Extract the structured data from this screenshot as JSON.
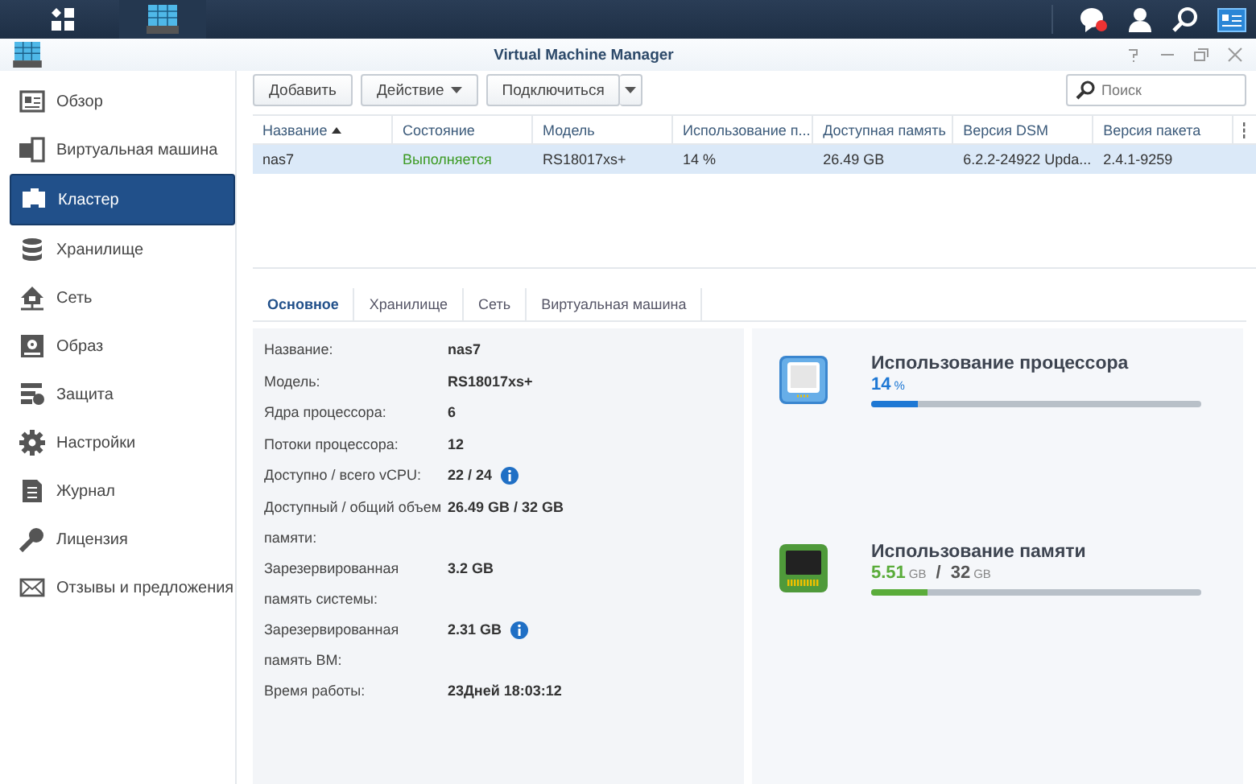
{
  "window": {
    "title": "Virtual Machine Manager"
  },
  "sidebar": {
    "items": [
      {
        "label": "Обзор",
        "selected": false
      },
      {
        "label": "Виртуальная машина",
        "selected": false
      },
      {
        "label": "Кластер",
        "selected": true
      },
      {
        "label": "Хранилище",
        "selected": false
      },
      {
        "label": "Сеть",
        "selected": false
      },
      {
        "label": "Образ",
        "selected": false
      },
      {
        "label": "Защита",
        "selected": false
      },
      {
        "label": "Настройки",
        "selected": false
      },
      {
        "label": "Журнал",
        "selected": false
      },
      {
        "label": "Лицензия",
        "selected": false
      },
      {
        "label": "Отзывы и предложения",
        "selected": false
      }
    ]
  },
  "toolbar": {
    "buttons": [
      {
        "label": "Добавить",
        "kind": "plain"
      },
      {
        "label": "Действие",
        "kind": "menu"
      },
      {
        "label": "Подключиться",
        "kind": "split"
      }
    ],
    "search": {
      "placeholder": "Поиск"
    }
  },
  "table": {
    "columns": [
      {
        "label": "Название",
        "sorted": true
      },
      {
        "label": "Состояние",
        "sorted": false
      },
      {
        "label": "Модель",
        "sorted": false
      },
      {
        "label": "Использование п...",
        "sorted": false
      },
      {
        "label": "Доступная память",
        "sorted": false
      },
      {
        "label": "Версия DSM",
        "sorted": false
      },
      {
        "label": "Версия пакета",
        "sorted": false
      }
    ],
    "rows": [
      {
        "selected": true,
        "cells": [
          {
            "text": "nas7",
            "kind": "plain"
          },
          {
            "text": "Выполняется",
            "kind": "status"
          },
          {
            "text": "RS18017xs+",
            "kind": "plain"
          },
          {
            "text": "14 %",
            "kind": "plain"
          },
          {
            "text": "26.49 GB",
            "kind": "plain"
          },
          {
            "text": "6.2.2-24922 Upda...",
            "kind": "plain"
          },
          {
            "text": "2.4.1-9259",
            "kind": "plain"
          }
        ]
      }
    ]
  },
  "tabs": [
    {
      "label": "Основное",
      "selected": true
    },
    {
      "label": "Хранилище",
      "selected": false
    },
    {
      "label": "Сеть",
      "selected": false
    },
    {
      "label": "Виртуальная машина",
      "selected": false
    }
  ],
  "details": [
    {
      "label": "Название:",
      "value": "nas7",
      "info": false
    },
    {
      "label": "Модель:",
      "value": "RS18017xs+",
      "info": false
    },
    {
      "label": "Ядра процессора:",
      "value": "6",
      "info": false
    },
    {
      "label": "Потоки процессора:",
      "value": "12",
      "info": false
    },
    {
      "label": "Доступно / всего vCPU:",
      "value": "22 / 24",
      "info": true
    },
    {
      "label": "Доступный / общий объем памяти:",
      "value": "26.49 GB / 32 GB",
      "info": false
    },
    {
      "label": "Зарезервированная память системы:",
      "value": "3.2 GB",
      "info": false
    },
    {
      "label": "Зарезервированная память ВМ:",
      "value": "2.31 GB",
      "info": true
    },
    {
      "label": "Время работы:",
      "value": "23Дней 18:03:12",
      "info": false
    }
  ],
  "usage": [
    {
      "kind": "cpu",
      "title": "Использование процессора",
      "value": "14",
      "unit": "%",
      "level": 0.14
    },
    {
      "kind": "memory",
      "title": "Использование памяти",
      "value": "5.51",
      "unit": "GB",
      "separator": "/",
      "total": "32",
      "total_unit": "GB",
      "level": 0.17
    }
  ]
}
